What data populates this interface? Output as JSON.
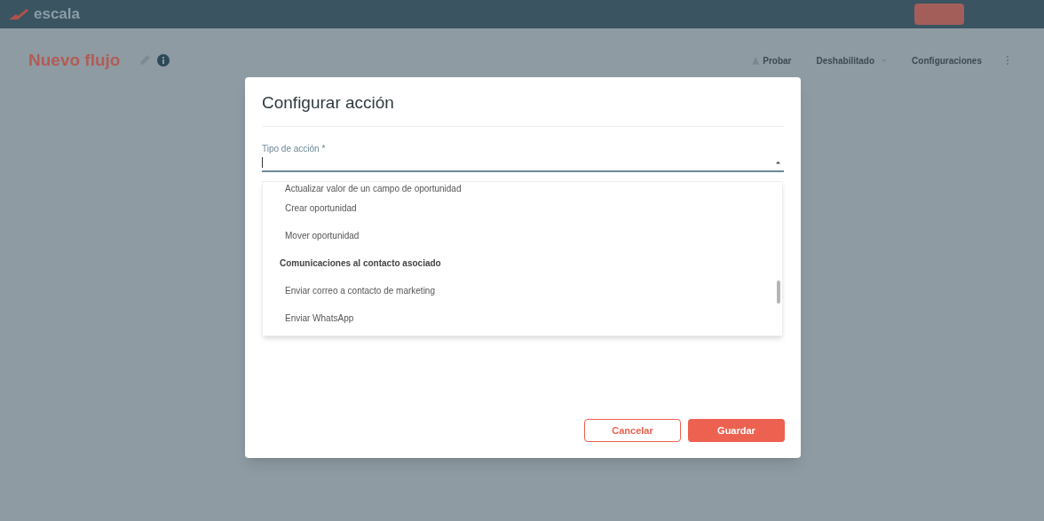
{
  "header": {
    "logo": "escala"
  },
  "page": {
    "title": "Nuevo flujo",
    "actions": [
      {
        "label": "Probar",
        "kind": "icon"
      },
      {
        "label": "Deshabilitado",
        "kind": "dropdown"
      },
      {
        "label": "Configuraciones",
        "kind": "plain"
      }
    ]
  },
  "dialog": {
    "title": "Configurar acción",
    "field": {
      "label": "Tipo de acción *",
      "expanded": true
    },
    "options": [
      {
        "kind": "option",
        "label": "Actualizar valor de un campo de oportunidad"
      },
      {
        "kind": "option",
        "label": "Crear oportunidad"
      },
      {
        "kind": "option",
        "label": "Mover oportunidad"
      },
      {
        "kind": "group",
        "label": "Comunicaciones al contacto asociado"
      },
      {
        "kind": "option",
        "label": "Enviar correo a contacto de marketing"
      },
      {
        "kind": "option",
        "label": "Enviar WhatsApp"
      }
    ],
    "buttons": [
      {
        "label": "Cancelar",
        "kind": "secondary"
      },
      {
        "label": "Guardar",
        "kind": "primary"
      }
    ]
  }
}
